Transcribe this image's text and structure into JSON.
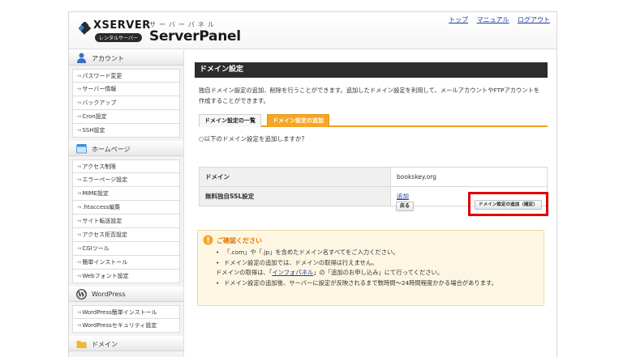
{
  "header": {
    "logo_xserver": "XSERVER",
    "logo_rental": "レンタルサーバー",
    "logo_kana": "サーバーパネル",
    "logo_serverpanel": "ServerPanel",
    "nav": [
      "トップ",
      "マニュアル",
      "ログアウト"
    ]
  },
  "sidebar": {
    "sections": [
      {
        "title": "アカウント",
        "icon": "user-icon",
        "items": [
          "パスワード変更",
          "サーバー情報",
          "バックアップ",
          "Cron設定",
          "SSH設定"
        ]
      },
      {
        "title": "ホームページ",
        "icon": "homepage-icon",
        "items": [
          "アクセス制限",
          "エラーページ設定",
          "MIME設定",
          ".htaccess編集",
          "サイト転送設定",
          "アクセス拒否設定",
          "CGIツール",
          "簡単インストール",
          "Webフォント設定"
        ]
      },
      {
        "title": "WordPress",
        "icon": "wordpress-icon",
        "items": [
          "WordPress簡単インストール",
          "WordPressセキュリティ設定"
        ]
      },
      {
        "title": "ドメイン",
        "icon": "folder-icon",
        "items": []
      }
    ],
    "arrow": "-›"
  },
  "main": {
    "title": "ドメイン設定",
    "description": "独自ドメイン設定の追加、削除を行うことができます。追加したドメイン設定を利用して、メールアカウントやFTPアカウントを作成することができます。",
    "tabs": [
      "ドメイン設定の一覧",
      "ドメイン設定の追加"
    ],
    "question": "○以下のドメイン設定を追加しますか？",
    "table": {
      "domain_label": "ドメイン",
      "domain_value": "bookskey.org",
      "ssl_label": "無料独自SSL設定",
      "ssl_value": "追加"
    },
    "back_button": "戻る",
    "confirm_button": "ドメイン設定の追加（確定）",
    "notice": {
      "title": "ご確認ください",
      "line1": "「.com」や「.jp」を含めたドメイン名すべてをご入力ください。",
      "line2": "ドメイン設定の追加では、ドメインの取得は行えません。",
      "line3_pre": "ドメインの取得は、「",
      "line3_link": "インフォパネル",
      "line3_post": "」の「追加のお申し込み」にて行ってください。",
      "line4": "ドメイン設定の追加後、サーバーに設定が反映されるまで数時間～24時間程度かかる場合があります。",
      "bullet": "•"
    }
  },
  "colors": {
    "accent": "#f5a623",
    "highlight": "#e00000",
    "link": "#1a3fa8",
    "title_bar": "#2d2d2d"
  }
}
